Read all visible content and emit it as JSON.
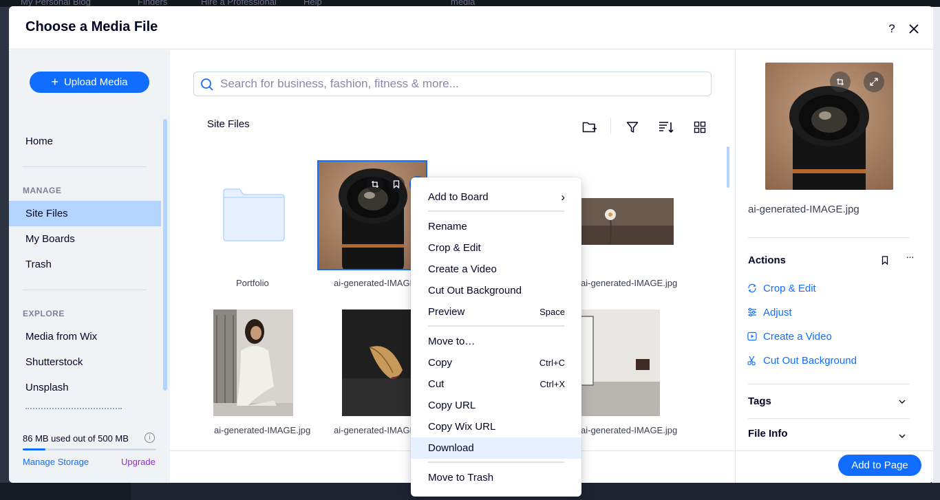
{
  "backdrop": {
    "topbar_items": [
      "My Personal Blog",
      "Finders",
      "Hire a Professional",
      "Help",
      "media"
    ]
  },
  "modal": {
    "title": "Choose a Media File",
    "help_label": "?"
  },
  "sidebar": {
    "upload_label": "Upload Media",
    "home": "Home",
    "manage_heading": "MANAGE",
    "manage_items": [
      "Site Files",
      "My Boards",
      "Trash"
    ],
    "explore_heading": "EXPLORE",
    "explore_items": [
      "Media from Wix",
      "Shutterstock",
      "Unsplash"
    ],
    "storage_text": "86 MB used out of 500 MB",
    "storage_used_fraction": 0.172,
    "manage_storage": "Manage Storage",
    "upgrade": "Upgrade"
  },
  "main": {
    "search_placeholder": "Search for business, fashion, fitness & more...",
    "section_title": "Site Files",
    "tiles": [
      {
        "caption": "Portfolio",
        "kind": "folder"
      },
      {
        "caption": "ai-generated-IMAGE.jpg",
        "kind": "lens"
      },
      {
        "caption": "ai-generated-IMAGE.jpg",
        "kind": "flower"
      },
      {
        "caption": "ai-generated-IMAGE.jpg",
        "kind": "woman"
      },
      {
        "caption": "ai-generated-IMAGE.jpg",
        "kind": "petal"
      },
      {
        "caption": "ai-generated-IMAGE.jpg",
        "kind": "room"
      }
    ]
  },
  "context_menu": {
    "items": [
      {
        "label": "Add to Board",
        "shortcut": "›"
      },
      {
        "label": "Rename",
        "shortcut": ""
      },
      {
        "label": "Crop & Edit",
        "shortcut": ""
      },
      {
        "label": "Create a Video",
        "shortcut": ""
      },
      {
        "label": "Cut Out Background",
        "shortcut": ""
      },
      {
        "label": "Preview",
        "shortcut": "Space"
      },
      {
        "label": "Move to…",
        "shortcut": ""
      },
      {
        "label": "Copy",
        "shortcut": "Ctrl+C"
      },
      {
        "label": "Cut",
        "shortcut": "Ctrl+X"
      },
      {
        "label": "Copy URL",
        "shortcut": ""
      },
      {
        "label": "Copy Wix URL",
        "shortcut": ""
      },
      {
        "label": "Download",
        "shortcut": ""
      },
      {
        "label": "Move to Trash",
        "shortcut": ""
      }
    ],
    "highlighted": "Download"
  },
  "right_panel": {
    "file_name": "ai-generated-IMAGE.jpg",
    "actions_heading": "Actions",
    "actions": [
      {
        "label": "Crop & Edit",
        "icon": "crop-rotate-icon"
      },
      {
        "label": "Adjust",
        "icon": "sliders-icon"
      },
      {
        "label": "Create a Video",
        "icon": "video-icon"
      },
      {
        "label": "Cut Out Background",
        "icon": "scissors-icon"
      }
    ],
    "tags_heading": "Tags",
    "file_info_heading": "File Info",
    "add_button": "Add to Page"
  },
  "colors": {
    "accent": "#116dff",
    "active_nav": "#b3d4ff",
    "upgrade": "#9a27d5"
  }
}
